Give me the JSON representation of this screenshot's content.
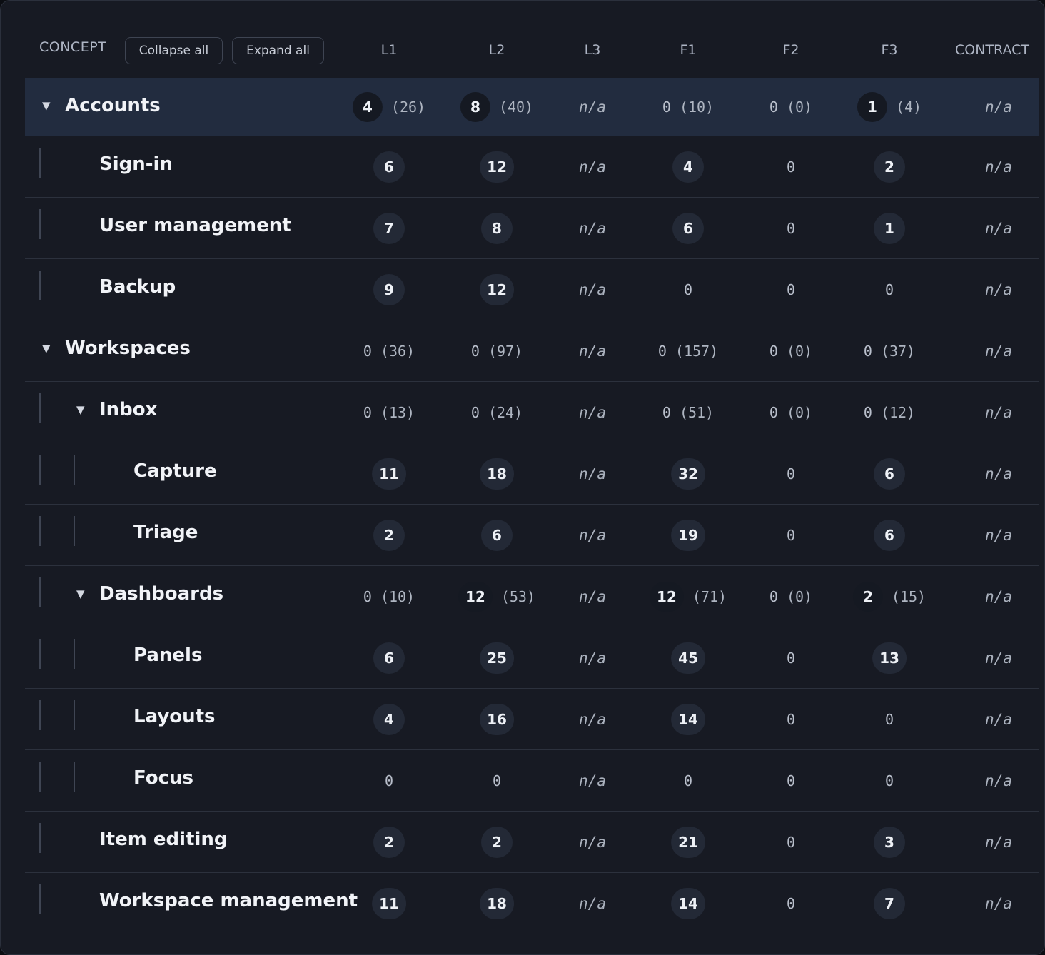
{
  "header": {
    "concept_label": "CONCEPT",
    "collapse_all": "Collapse all",
    "expand_all": "Expand all",
    "columns": [
      "L1",
      "L2",
      "L3",
      "F1",
      "F2",
      "F3",
      "CONTRACT"
    ]
  },
  "rows": [
    {
      "name": "Accounts",
      "level": 0,
      "expandable": true,
      "selected": true,
      "cells": [
        {
          "v": "4",
          "p": "(26)",
          "b": true
        },
        {
          "v": "8",
          "p": "(40)",
          "b": true
        },
        {
          "na": "n/a"
        },
        {
          "v": "0",
          "p": "(10)"
        },
        {
          "v": "0",
          "p": "(0)"
        },
        {
          "v": "1",
          "p": "(4)",
          "b": true
        },
        {
          "na": "n/a"
        }
      ]
    },
    {
      "name": "Sign-in",
      "level": 1,
      "cells": [
        {
          "v": "6",
          "b": true
        },
        {
          "v": "12",
          "b": true
        },
        {
          "na": "n/a"
        },
        {
          "v": "4",
          "b": true
        },
        {
          "v": "0"
        },
        {
          "v": "2",
          "b": true
        },
        {
          "na": "n/a"
        }
      ]
    },
    {
      "name": "User management",
      "level": 1,
      "cells": [
        {
          "v": "7",
          "b": true
        },
        {
          "v": "8",
          "b": true
        },
        {
          "na": "n/a"
        },
        {
          "v": "6",
          "b": true
        },
        {
          "v": "0"
        },
        {
          "v": "1",
          "b": true
        },
        {
          "na": "n/a"
        }
      ]
    },
    {
      "name": "Backup",
      "level": 1,
      "cells": [
        {
          "v": "9",
          "b": true
        },
        {
          "v": "12",
          "b": true
        },
        {
          "na": "n/a"
        },
        {
          "v": "0"
        },
        {
          "v": "0"
        },
        {
          "v": "0"
        },
        {
          "na": "n/a"
        }
      ]
    },
    {
      "name": "Workspaces",
      "level": 0,
      "expandable": true,
      "cells": [
        {
          "v": "0",
          "p": "(36)"
        },
        {
          "v": "0",
          "p": "(97)"
        },
        {
          "na": "n/a"
        },
        {
          "v": "0",
          "p": "(157)"
        },
        {
          "v": "0",
          "p": "(0)"
        },
        {
          "v": "0",
          "p": "(37)"
        },
        {
          "na": "n/a"
        }
      ]
    },
    {
      "name": "Inbox",
      "level": 1,
      "expandable": true,
      "cells": [
        {
          "v": "0",
          "p": "(13)"
        },
        {
          "v": "0",
          "p": "(24)"
        },
        {
          "na": "n/a"
        },
        {
          "v": "0",
          "p": "(51)"
        },
        {
          "v": "0",
          "p": "(0)"
        },
        {
          "v": "0",
          "p": "(12)"
        },
        {
          "na": "n/a"
        }
      ]
    },
    {
      "name": "Capture",
      "level": 2,
      "cells": [
        {
          "v": "11",
          "b": true
        },
        {
          "v": "18",
          "b": true
        },
        {
          "na": "n/a"
        },
        {
          "v": "32",
          "b": true
        },
        {
          "v": "0"
        },
        {
          "v": "6",
          "b": true
        },
        {
          "na": "n/a"
        }
      ]
    },
    {
      "name": "Triage",
      "level": 2,
      "cells": [
        {
          "v": "2",
          "b": true
        },
        {
          "v": "6",
          "b": true
        },
        {
          "na": "n/a"
        },
        {
          "v": "19",
          "b": true
        },
        {
          "v": "0"
        },
        {
          "v": "6",
          "b": true
        },
        {
          "na": "n/a"
        }
      ]
    },
    {
      "name": "Dashboards",
      "level": 1,
      "expandable": true,
      "cells": [
        {
          "v": "0",
          "p": "(10)"
        },
        {
          "v": "12",
          "p": "(53)",
          "b": true
        },
        {
          "na": "n/a"
        },
        {
          "v": "12",
          "p": "(71)",
          "b": true
        },
        {
          "v": "0",
          "p": "(0)"
        },
        {
          "v": "2",
          "p": "(15)",
          "b": true
        },
        {
          "na": "n/a"
        }
      ]
    },
    {
      "name": "Panels",
      "level": 2,
      "cells": [
        {
          "v": "6",
          "b": true
        },
        {
          "v": "25",
          "b": true
        },
        {
          "na": "n/a"
        },
        {
          "v": "45",
          "b": true
        },
        {
          "v": "0"
        },
        {
          "v": "13",
          "b": true
        },
        {
          "na": "n/a"
        }
      ]
    },
    {
      "name": "Layouts",
      "level": 2,
      "cells": [
        {
          "v": "4",
          "b": true
        },
        {
          "v": "16",
          "b": true
        },
        {
          "na": "n/a"
        },
        {
          "v": "14",
          "b": true
        },
        {
          "v": "0"
        },
        {
          "v": "0"
        },
        {
          "na": "n/a"
        }
      ]
    },
    {
      "name": "Focus",
      "level": 2,
      "cells": [
        {
          "v": "0"
        },
        {
          "v": "0"
        },
        {
          "na": "n/a"
        },
        {
          "v": "0"
        },
        {
          "v": "0"
        },
        {
          "v": "0"
        },
        {
          "na": "n/a"
        }
      ]
    },
    {
      "name": "Item editing",
      "level": 1,
      "cells": [
        {
          "v": "2",
          "b": true
        },
        {
          "v": "2",
          "b": true
        },
        {
          "na": "n/a"
        },
        {
          "v": "21",
          "b": true
        },
        {
          "v": "0"
        },
        {
          "v": "3",
          "b": true
        },
        {
          "na": "n/a"
        }
      ]
    },
    {
      "name": "Workspace management",
      "level": 1,
      "cells": [
        {
          "v": "11",
          "b": true
        },
        {
          "v": "18",
          "b": true
        },
        {
          "na": "n/a"
        },
        {
          "v": "14",
          "b": true
        },
        {
          "v": "0"
        },
        {
          "v": "7",
          "b": true
        },
        {
          "na": "n/a"
        }
      ]
    }
  ]
}
